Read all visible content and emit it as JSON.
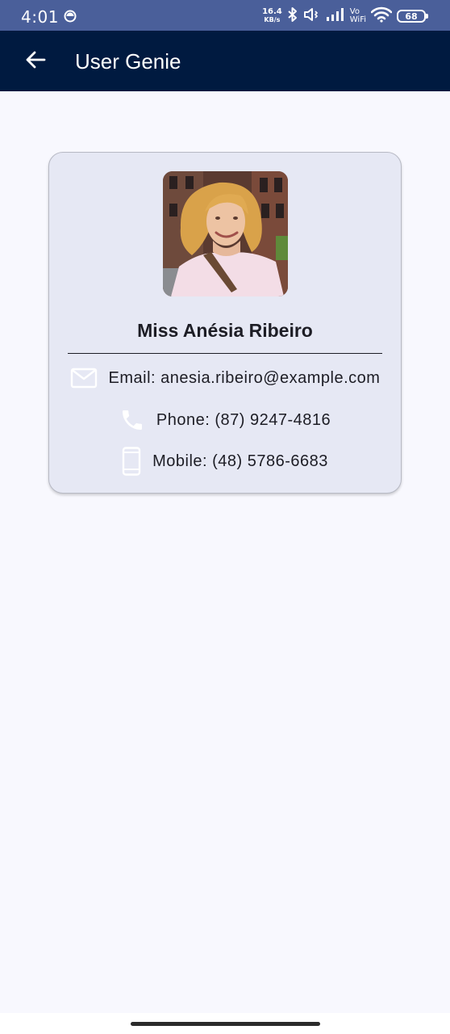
{
  "status_bar": {
    "time": "4:01",
    "net_speed_value": "16.4",
    "net_speed_unit": "KB/s",
    "vowifi_top": "Vo",
    "vowifi_bottom": "WiFi",
    "battery": "68"
  },
  "app_bar": {
    "title": "User Genie"
  },
  "user": {
    "name": "Miss Anésia Ribeiro",
    "email_label": "Email: anesia.ribeiro@example.com",
    "phone_label": "Phone: (87) 9247-4816",
    "mobile_label": "Mobile: (48) 5786-6683"
  },
  "icons": {
    "back": "arrow-back-icon",
    "email": "mail-icon",
    "phone": "phone-icon",
    "mobile": "smartphone-icon"
  },
  "colors": {
    "status_bar": "#4a5f9a",
    "app_bar": "#001a40",
    "card_background": "#e6e8f4",
    "page_background": "#f8f8fe"
  }
}
